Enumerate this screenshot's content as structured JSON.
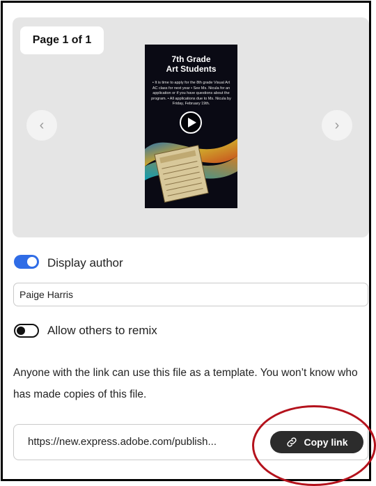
{
  "preview": {
    "page_indicator": "Page 1 of 1",
    "thumbnail": {
      "title_line1": "7th Grade",
      "title_line2": "Art Students",
      "body": "• It is time to apply for the 8th grade Visual Art AC class for next year • See Ms. Nicula for an application or if you have questions about the program. • All applications due to Ms. Nicula by Friday, February 19th."
    }
  },
  "display_author": {
    "label": "Display author",
    "enabled": true
  },
  "author_name": {
    "value": "Paige Harris"
  },
  "allow_remix": {
    "label": "Allow others to remix",
    "enabled": false
  },
  "description": "Anyone with the link can use this file as a template. You won’t know who has made copies of this file.",
  "share_link": {
    "url": "https://new.express.adobe.com/publish...",
    "copy_label": "Copy link"
  },
  "colors": {
    "accent": "#2f6ce6",
    "button_dark": "#2c2c2c",
    "annotation_red": "#b4121c"
  }
}
